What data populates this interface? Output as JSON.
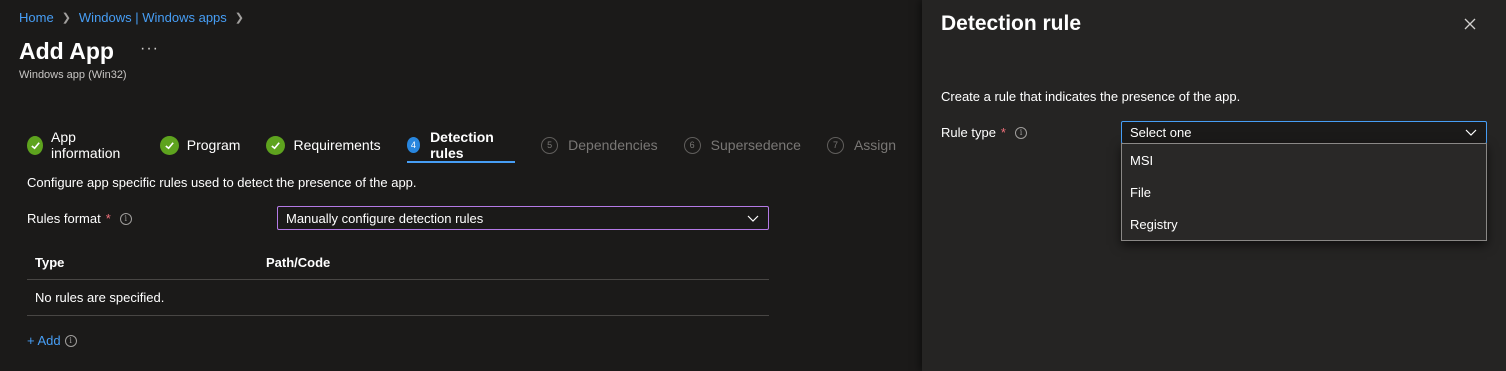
{
  "breadcrumb": {
    "home": "Home",
    "windows": "Windows | Windows apps"
  },
  "page": {
    "title": "Add App",
    "more": "···",
    "subtitle": "Windows app (Win32)"
  },
  "wizard": {
    "steps": [
      {
        "label": "App information",
        "state": "done"
      },
      {
        "label": "Program",
        "state": "done"
      },
      {
        "label": "Requirements",
        "state": "done"
      },
      {
        "number": "4",
        "label": "Detection rules",
        "state": "active"
      },
      {
        "number": "5",
        "label": "Dependencies",
        "state": "disabled"
      },
      {
        "number": "6",
        "label": "Supersedence",
        "state": "disabled"
      },
      {
        "number": "7",
        "label": "Assign",
        "state": "disabled"
      }
    ]
  },
  "detection": {
    "description": "Configure app specific rules used to detect the presence of the app.",
    "rules_format_label": "Rules format",
    "required_mark": "*",
    "rules_format_value": "Manually configure detection rules",
    "table": {
      "columns": [
        "Type",
        "Path/Code"
      ],
      "empty_text": "No rules are specified."
    },
    "add_label": "+ Add"
  },
  "panel": {
    "title": "Detection rule",
    "description": "Create a rule that indicates the presence of the app.",
    "rule_type_label": "Rule type",
    "required_mark": "*",
    "rule_type_placeholder": "Select one",
    "options": [
      "MSI",
      "File",
      "Registry"
    ]
  },
  "colors": {
    "accent": "#479ef5",
    "success": "#5ea31e",
    "required": "#f1707b",
    "focus_border": "#b47ae6",
    "background": "#1b1a19",
    "panel_background": "#252423"
  }
}
